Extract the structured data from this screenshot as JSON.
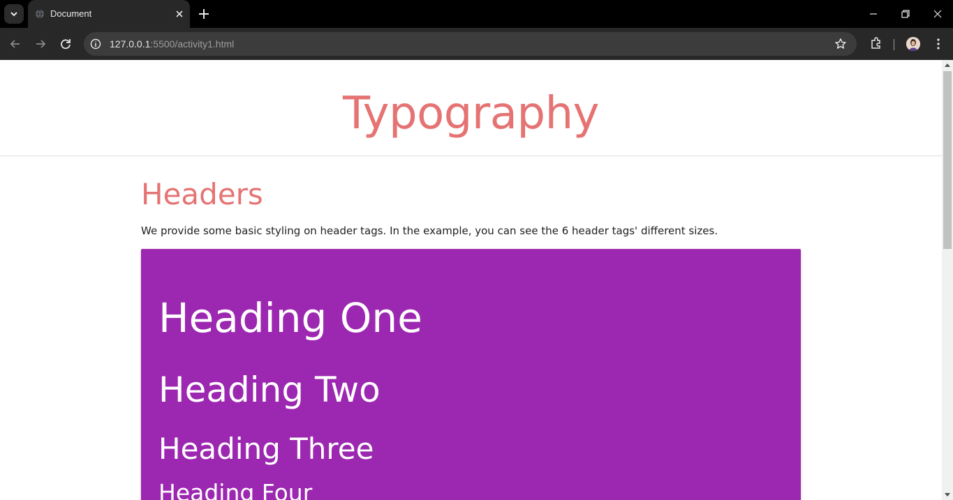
{
  "browser": {
    "tab_title": "Document",
    "url_host": "127.0.0.1",
    "url_rest": ":5500/activity1.html"
  },
  "page": {
    "title": "Typography",
    "section_title": "Headers",
    "section_desc": "We provide some basic styling on header tags. In the example, you can see the 6 header tags' different sizes.",
    "headings": [
      "Heading One",
      "Heading Two",
      "Heading Three",
      "Heading Four"
    ]
  },
  "colors": {
    "accent": "#e57373",
    "card": "#9c27b0"
  },
  "icons": [
    "tab-search-icon",
    "globe-icon",
    "close-icon",
    "plus-icon",
    "minimize-icon",
    "restore-icon",
    "back-icon",
    "forward-icon",
    "reload-icon",
    "info-icon",
    "star-icon",
    "extensions-icon",
    "kebab-menu-icon"
  ]
}
